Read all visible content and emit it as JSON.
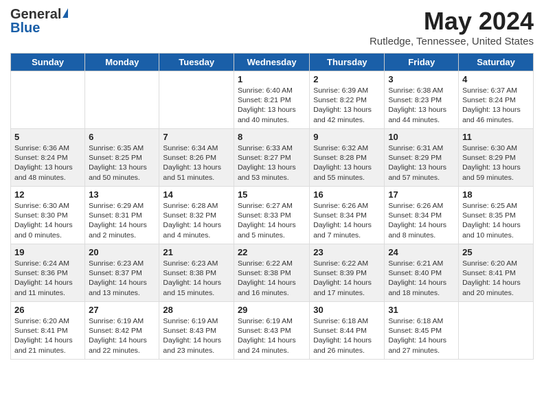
{
  "header": {
    "logo_general": "General",
    "logo_blue": "Blue",
    "title": "May 2024",
    "location": "Rutledge, Tennessee, United States"
  },
  "days_of_week": [
    "Sunday",
    "Monday",
    "Tuesday",
    "Wednesday",
    "Thursday",
    "Friday",
    "Saturday"
  ],
  "weeks": [
    [
      {
        "day": "",
        "info": ""
      },
      {
        "day": "",
        "info": ""
      },
      {
        "day": "",
        "info": ""
      },
      {
        "day": "1",
        "info": "Sunrise: 6:40 AM\nSunset: 8:21 PM\nDaylight: 13 hours\nand 40 minutes."
      },
      {
        "day": "2",
        "info": "Sunrise: 6:39 AM\nSunset: 8:22 PM\nDaylight: 13 hours\nand 42 minutes."
      },
      {
        "day": "3",
        "info": "Sunrise: 6:38 AM\nSunset: 8:23 PM\nDaylight: 13 hours\nand 44 minutes."
      },
      {
        "day": "4",
        "info": "Sunrise: 6:37 AM\nSunset: 8:24 PM\nDaylight: 13 hours\nand 46 minutes."
      }
    ],
    [
      {
        "day": "5",
        "info": "Sunrise: 6:36 AM\nSunset: 8:24 PM\nDaylight: 13 hours\nand 48 minutes."
      },
      {
        "day": "6",
        "info": "Sunrise: 6:35 AM\nSunset: 8:25 PM\nDaylight: 13 hours\nand 50 minutes."
      },
      {
        "day": "7",
        "info": "Sunrise: 6:34 AM\nSunset: 8:26 PM\nDaylight: 13 hours\nand 51 minutes."
      },
      {
        "day": "8",
        "info": "Sunrise: 6:33 AM\nSunset: 8:27 PM\nDaylight: 13 hours\nand 53 minutes."
      },
      {
        "day": "9",
        "info": "Sunrise: 6:32 AM\nSunset: 8:28 PM\nDaylight: 13 hours\nand 55 minutes."
      },
      {
        "day": "10",
        "info": "Sunrise: 6:31 AM\nSunset: 8:29 PM\nDaylight: 13 hours\nand 57 minutes."
      },
      {
        "day": "11",
        "info": "Sunrise: 6:30 AM\nSunset: 8:29 PM\nDaylight: 13 hours\nand 59 minutes."
      }
    ],
    [
      {
        "day": "12",
        "info": "Sunrise: 6:30 AM\nSunset: 8:30 PM\nDaylight: 14 hours\nand 0 minutes."
      },
      {
        "day": "13",
        "info": "Sunrise: 6:29 AM\nSunset: 8:31 PM\nDaylight: 14 hours\nand 2 minutes."
      },
      {
        "day": "14",
        "info": "Sunrise: 6:28 AM\nSunset: 8:32 PM\nDaylight: 14 hours\nand 4 minutes."
      },
      {
        "day": "15",
        "info": "Sunrise: 6:27 AM\nSunset: 8:33 PM\nDaylight: 14 hours\nand 5 minutes."
      },
      {
        "day": "16",
        "info": "Sunrise: 6:26 AM\nSunset: 8:34 PM\nDaylight: 14 hours\nand 7 minutes."
      },
      {
        "day": "17",
        "info": "Sunrise: 6:26 AM\nSunset: 8:34 PM\nDaylight: 14 hours\nand 8 minutes."
      },
      {
        "day": "18",
        "info": "Sunrise: 6:25 AM\nSunset: 8:35 PM\nDaylight: 14 hours\nand 10 minutes."
      }
    ],
    [
      {
        "day": "19",
        "info": "Sunrise: 6:24 AM\nSunset: 8:36 PM\nDaylight: 14 hours\nand 11 minutes."
      },
      {
        "day": "20",
        "info": "Sunrise: 6:23 AM\nSunset: 8:37 PM\nDaylight: 14 hours\nand 13 minutes."
      },
      {
        "day": "21",
        "info": "Sunrise: 6:23 AM\nSunset: 8:38 PM\nDaylight: 14 hours\nand 15 minutes."
      },
      {
        "day": "22",
        "info": "Sunrise: 6:22 AM\nSunset: 8:38 PM\nDaylight: 14 hours\nand 16 minutes."
      },
      {
        "day": "23",
        "info": "Sunrise: 6:22 AM\nSunset: 8:39 PM\nDaylight: 14 hours\nand 17 minutes."
      },
      {
        "day": "24",
        "info": "Sunrise: 6:21 AM\nSunset: 8:40 PM\nDaylight: 14 hours\nand 18 minutes."
      },
      {
        "day": "25",
        "info": "Sunrise: 6:20 AM\nSunset: 8:41 PM\nDaylight: 14 hours\nand 20 minutes."
      }
    ],
    [
      {
        "day": "26",
        "info": "Sunrise: 6:20 AM\nSunset: 8:41 PM\nDaylight: 14 hours\nand 21 minutes."
      },
      {
        "day": "27",
        "info": "Sunrise: 6:19 AM\nSunset: 8:42 PM\nDaylight: 14 hours\nand 22 minutes."
      },
      {
        "day": "28",
        "info": "Sunrise: 6:19 AM\nSunset: 8:43 PM\nDaylight: 14 hours\nand 23 minutes."
      },
      {
        "day": "29",
        "info": "Sunrise: 6:19 AM\nSunset: 8:43 PM\nDaylight: 14 hours\nand 24 minutes."
      },
      {
        "day": "30",
        "info": "Sunrise: 6:18 AM\nSunset: 8:44 PM\nDaylight: 14 hours\nand 26 minutes."
      },
      {
        "day": "31",
        "info": "Sunrise: 6:18 AM\nSunset: 8:45 PM\nDaylight: 14 hours\nand 27 minutes."
      },
      {
        "day": "",
        "info": ""
      }
    ]
  ]
}
